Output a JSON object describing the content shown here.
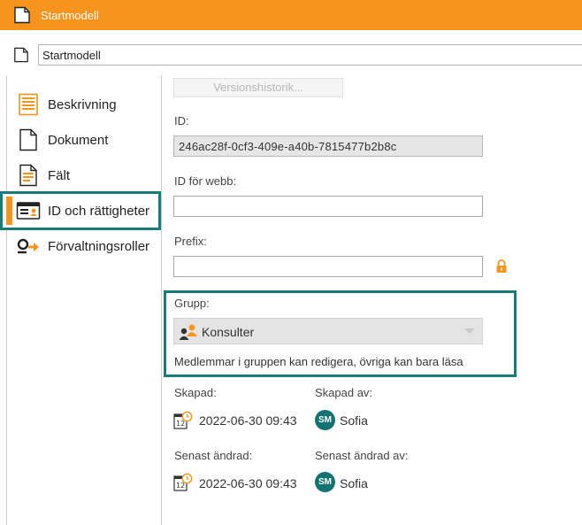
{
  "window": {
    "title": "Startmodell"
  },
  "name_field": {
    "value": "Startmodell"
  },
  "sidebar": {
    "items": [
      {
        "label": "Beskrivning",
        "icon": "description-icon"
      },
      {
        "label": "Dokument",
        "icon": "document-icon"
      },
      {
        "label": "Fält",
        "icon": "fields-icon"
      },
      {
        "label": "ID och rättigheter",
        "icon": "id-card-icon",
        "active": true
      },
      {
        "label": "Förvaltningsroller",
        "icon": "roles-icon"
      }
    ]
  },
  "main": {
    "version_history_label": "Versionshistorik...",
    "id": {
      "label": "ID:",
      "value": "246ac28f-0cf3-409e-a40b-7815477b2b8c"
    },
    "web_id": {
      "label": "ID för webb:",
      "value": ""
    },
    "prefix": {
      "label": "Prefix:",
      "value": ""
    },
    "group": {
      "label": "Grupp:",
      "selected": "Konsulter",
      "description": "Medlemmar i gruppen kan redigera, övriga kan bara läsa"
    },
    "created": {
      "label": "Skapad:",
      "date": "2022-06-30 09:43",
      "by_label": "Skapad av:",
      "by_initials": "SM",
      "by_name": "Sofia"
    },
    "modified": {
      "label": "Senast ändrad:",
      "date": "2022-06-30 09:43",
      "by_label": "Senast ändrad av:",
      "by_initials": "SM",
      "by_name": "Sofia"
    }
  },
  "colors": {
    "accent": "#f7941d",
    "highlight": "#1a7b7b",
    "avatar": "#137373"
  }
}
